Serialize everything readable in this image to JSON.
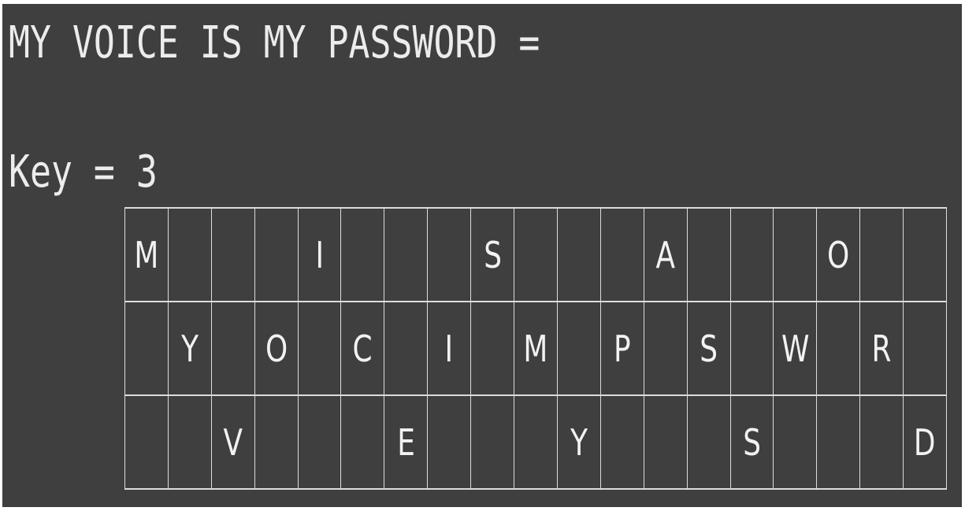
{
  "plaintext_line": "MY VOICE IS MY PASSWORD =",
  "key_line": "Key = 3",
  "rail_fence": {
    "rails": [
      [
        "M",
        "",
        "",
        "",
        "I",
        "",
        "",
        "",
        "S",
        "",
        "",
        "",
        "A",
        "",
        "",
        "",
        "O",
        "",
        ""
      ],
      [
        "",
        "Y",
        "",
        "O",
        "",
        "C",
        "",
        "I",
        "",
        "M",
        "",
        "P",
        "",
        "S",
        "",
        "W",
        "",
        "R",
        ""
      ],
      [
        "",
        "",
        "V",
        "",
        "",
        "",
        "E",
        "",
        "",
        "",
        "Y",
        "",
        "",
        "",
        "S",
        "",
        "",
        "",
        "D"
      ]
    ]
  }
}
